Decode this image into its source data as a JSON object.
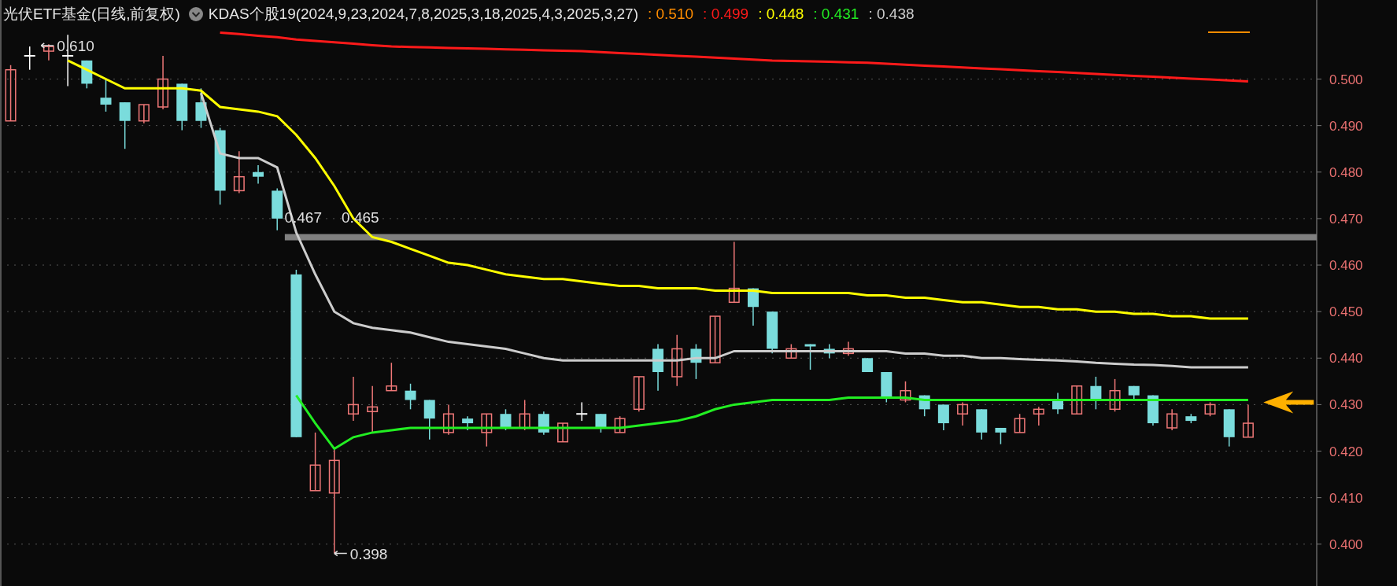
{
  "header": {
    "title": "光伏ETF基金(日线,前复权)",
    "indicator": "KDAS个股19(2024,9,23,2024,7,8,2025,3,18,2025,4,3,2025,3,27)",
    "values": [
      {
        "text": ": 0.510",
        "color": "#ff8c00"
      },
      {
        "text": ": 0.499",
        "color": "#ff1a1a"
      },
      {
        "text": ": 0.448",
        "color": "#ffff00"
      },
      {
        "text": ": 0.431",
        "color": "#22ee22"
      },
      {
        "text": ": 0.438",
        "color": "#cccccc"
      }
    ]
  },
  "chart": {
    "y_axis_labels": [
      "0.500",
      "0.490",
      "0.480",
      "0.470",
      "0.460",
      "0.450",
      "0.440",
      "0.430",
      "0.420",
      "0.410",
      "0.400"
    ],
    "price_labels": [
      {
        "text": "0.610",
        "kind": "pointer"
      },
      {
        "text": "0.467",
        "kind": "plain"
      },
      {
        "text": "0.465",
        "kind": "plain"
      },
      {
        "text": "0.398",
        "kind": "pointer"
      }
    ]
  }
}
